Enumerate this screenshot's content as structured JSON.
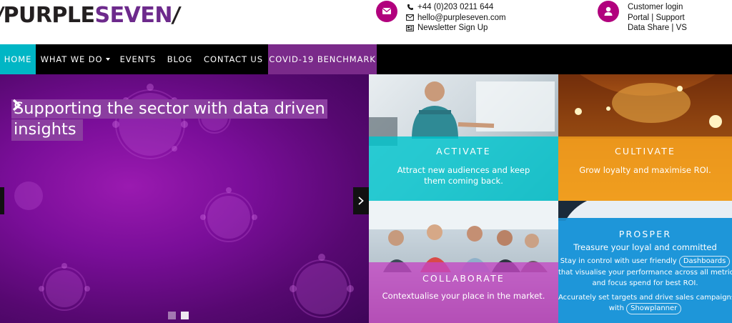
{
  "logo": {
    "slash_left": "/",
    "part1": "PURPLE",
    "part2": "SEVEN",
    "slash_right": "/"
  },
  "contact": {
    "phone": "+44 (0)203 0211 644",
    "email": "hello@purpleseven.com",
    "newsletter": "Newsletter Sign Up",
    "icons": [
      "envelope-icon",
      "phone-icon",
      "mail-icon",
      "newspaper-icon"
    ]
  },
  "login": {
    "title": "Customer login",
    "portal": "Portal",
    "support": "Support",
    "datashare": "Data Share",
    "vs": "VS",
    "sep": "|",
    "icon": "user-icon"
  },
  "nav": {
    "home": "HOME",
    "what_we_do": "WHAT WE DO",
    "events": "EVENTS",
    "blog": "BLOG",
    "contact": "CONTACT US",
    "covid": "COVID-19 BENCHMARK"
  },
  "hero": {
    "line1": "Supporting the sector with data driven",
    "line2": "insights"
  },
  "tiles": {
    "activate": {
      "title": "ACTIVATE",
      "text": "Attract new audiences and keep them coming back."
    },
    "cultivate": {
      "title": "CULTIVATE",
      "text": "Grow loyalty and maximise ROI."
    },
    "collaborate": {
      "title": "COLLABORATE",
      "text": "Contextualise your place in the market."
    },
    "prosper": {
      "title": "PROSPER",
      "subtitle": "Treasure your loyal and committed",
      "line1_pre": "Stay in control with user friendly",
      "line1_pill": "Dashboards",
      "line2": "that visualise your performance across all metrics",
      "line3": "and focus spend for best ROI.",
      "line4": "Accurately set targets and drive sales campaigns",
      "line5_pre": "with",
      "line5_pill": "Showplanner"
    }
  },
  "colors": {
    "brand_purple": "#6d2a8c",
    "magenta": "#b1007d",
    "teal": "#00b6c5",
    "nav_bg": "#000000",
    "orange": "#f19d1c",
    "blue": "#1f96d8"
  }
}
